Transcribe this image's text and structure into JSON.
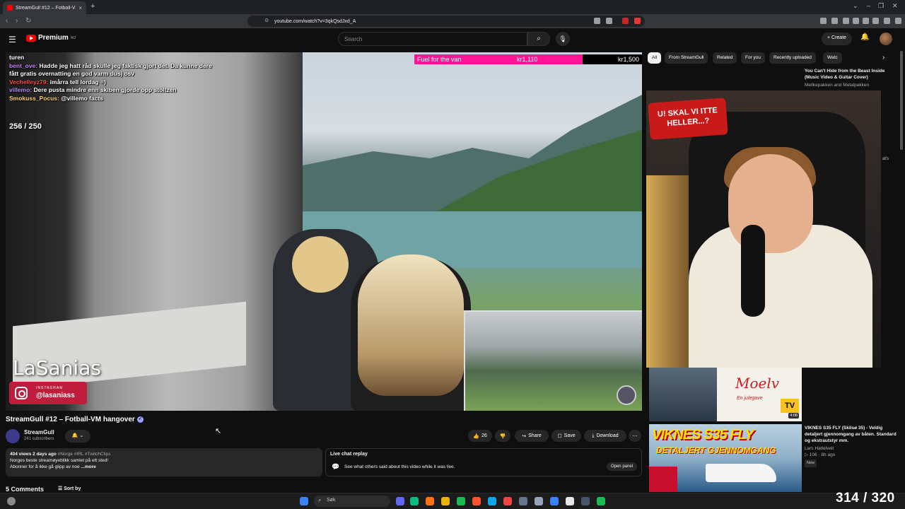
{
  "browser": {
    "tab_title": "StreamGull #12 – Fotball-VM",
    "tab_close": "×",
    "new_tab": "+",
    "url": "youtube.com/watch?v=3qkQsdJxd_A",
    "window_controls": [
      "⌄",
      "–",
      "❐",
      "✕"
    ]
  },
  "header": {
    "logo_text": "Premium",
    "logo_sup": "NO",
    "search_placeholder": "Search",
    "create_label": "+ Create"
  },
  "video": {
    "chat_lines": [
      {
        "user": "",
        "text": "turen"
      },
      {
        "user": "bent_ove:",
        "text": " Hadde jeg hatt råd skulle jeg faktisk gjort det. Da kunne dere fått gratis overnatting en god varm dusj osv"
      },
      {
        "user": "Vechelleyz79:",
        "text": " imårra tell lordag =)"
      },
      {
        "user": "villemo:",
        "text": " Dere pusta mindre enn skiben gjorde opp stoltzen"
      },
      {
        "user": "Smokuss_Pocus:",
        "text": " @villemo facts"
      }
    ],
    "counter": "256 / 250",
    "goal_label": "Fuel for the van",
    "goal_current": "kr1,110",
    "goal_target": "kr1,500",
    "goal_progress": 0.74,
    "streamer_name": "LaSanias",
    "ig_label": "INSTAGRAM",
    "ig_handle": "@lasaniass"
  },
  "info": {
    "title": "StreamGull #12 – Fotball-VM hangover",
    "channel": "StreamGull",
    "subscribers": "241 subscribers",
    "likes": "26",
    "share": "Share",
    "save": "Save",
    "download": "Download",
    "more": "⋯",
    "desc_meta": "404 views  2 days ago",
    "desc_tags": "#Norge #IRL #TwitchClips",
    "desc_line2": "Norges beste streamøyeblikk samlet på ett sted!",
    "desc_line3": "Abonner for å ikke gå glipp av noe",
    "desc_more": "...more",
    "live_chat_title": "Live chat replay",
    "live_chat_text": "See what others said about this video while it was live.",
    "open_panel": "Open panel",
    "comments": "5 Comments",
    "sort_by": "Sort by"
  },
  "sidebar": {
    "chips": [
      "All",
      "From StreamGull",
      "Related",
      "For you",
      "Recently uploaded",
      "Watc"
    ],
    "rec1_title": "You Can't Hide from the Beast Inside (Music Video & Guitar Cover)",
    "rec1_channel": "Mellkepakken and Metalpakken",
    "cam_sign": "U! SKAL VI ITTE HELLER...?",
    "side_fragment": "at's",
    "vid2_title": "Moelv",
    "vid2_sub": "En julegave",
    "vid2_tv": "TV",
    "vid2_duration": "4:08",
    "vid3_big": "VIKNES S35 FLY",
    "vid3_sub": "DETALJERT GJENNOMGANG",
    "rec3_title": "VIKNES S35 FLY  (Skilsø 35) - Veldig detaljert gjennomgang av båten. Standard og ekstrautstyr mm.",
    "rec3_channel": "Lars Hatlelvelt",
    "rec3_meta": "▷ 106 · 8h ago",
    "rec3_badge": "New"
  },
  "taskbar": {
    "search": "Søk"
  },
  "overlay_count": "314 / 320",
  "colors": {
    "youtube_red": "#ff0000",
    "goal_pink": "#ff1493",
    "instagram": "#c01c3c"
  }
}
